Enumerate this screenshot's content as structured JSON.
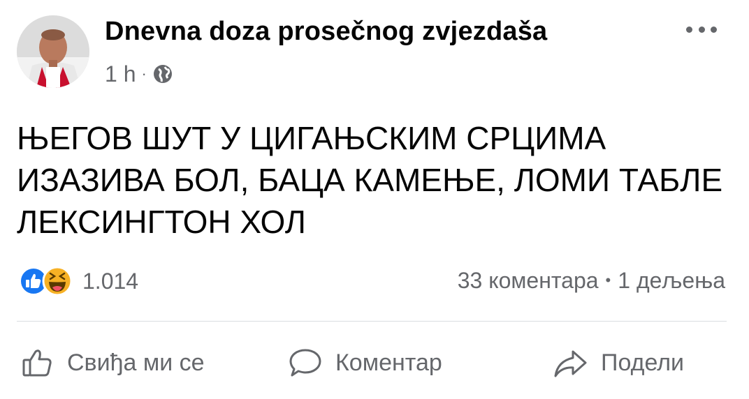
{
  "header": {
    "page_name": "Dnevna doza prosečnog zvjezdaša",
    "time": "1 h",
    "separator": "·",
    "privacy_icon": "globe-icon",
    "more_icon": "ellipsis-icon"
  },
  "post": {
    "lines": [
      "ЊЕГОВ ШУТ У ЦИГАЊСКИМ СРЦИМА",
      "ИЗАЗИВА БОЛ, БАЦА КАМЕЊЕ, ЛОМИ ТАБЛЕ",
      "ЛЕКСИНГТОН ХОЛ"
    ]
  },
  "stats": {
    "reaction_icons": [
      "like-reaction-icon",
      "haha-reaction-icon"
    ],
    "reaction_count": "1.014",
    "comments": "33 коментара",
    "separator": "•",
    "shares": "1 дељења"
  },
  "actions": {
    "like": "Свиђа ми се",
    "comment": "Коментар",
    "share": "Подели"
  },
  "colors": {
    "text_primary": "#050505",
    "text_secondary": "#65676b",
    "like_blue": "#1877f2",
    "haha_yellow": "#f7b125",
    "divider": "#dadde1"
  }
}
